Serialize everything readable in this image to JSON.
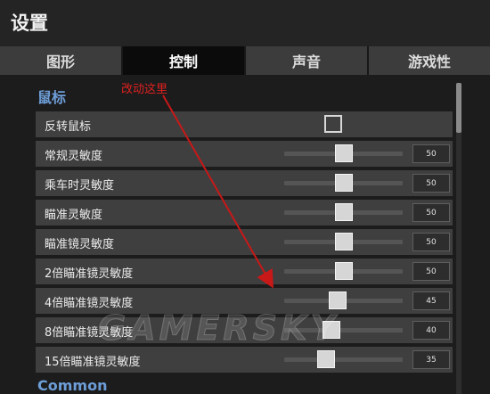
{
  "window": {
    "title": "设置"
  },
  "tabs": [
    {
      "label": "图形"
    },
    {
      "label": "控制"
    },
    {
      "label": "声音"
    },
    {
      "label": "游戏性"
    }
  ],
  "active_tab": "控制",
  "sections": [
    {
      "title": "鼠标"
    },
    {
      "title": "Common"
    }
  ],
  "mouse": {
    "invert": {
      "label": "反转鼠标",
      "checked": false
    },
    "sliders": [
      {
        "label": "常规灵敏度",
        "value": "50",
        "level": 50
      },
      {
        "label": "乘车时灵敏度",
        "value": "50",
        "level": 50
      },
      {
        "label": "瞄准灵敏度",
        "value": "50",
        "level": 50
      },
      {
        "label": "瞄准镜灵敏度",
        "value": "50",
        "level": 50
      },
      {
        "label": "2倍瞄准镜灵敏度",
        "value": "50",
        "level": 50
      },
      {
        "label": "4倍瞄准镜灵敏度",
        "value": "45",
        "level": 45
      },
      {
        "label": "8倍瞄准镜灵敏度",
        "value": "40",
        "level": 40
      },
      {
        "label": "15倍瞄准镜灵敏度",
        "value": "35",
        "level": 35
      }
    ]
  },
  "annotation": {
    "text": "改动这里",
    "color": "#e02020"
  },
  "watermark": {
    "text": "GAMERSKY"
  },
  "colors": {
    "section_title": "#6e9ed8",
    "row_bg": "#3f3f3f",
    "active_tab": "#0b0b0b"
  }
}
